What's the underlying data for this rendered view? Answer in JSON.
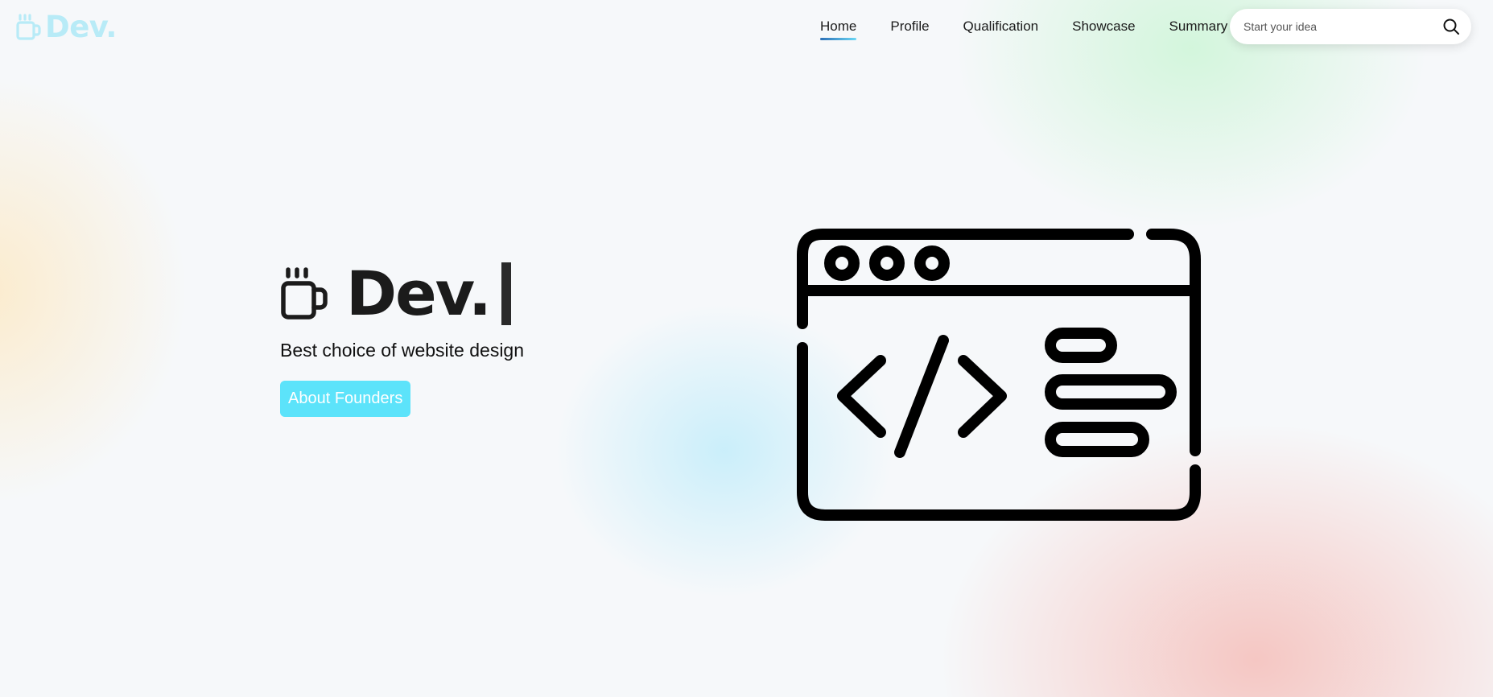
{
  "brand": {
    "name": "Dev.",
    "icon": "mug-icon",
    "color": "#b8ebf7"
  },
  "nav": {
    "items": [
      {
        "label": "Home",
        "active": true
      },
      {
        "label": "Profile",
        "active": false
      },
      {
        "label": "Qualification",
        "active": false
      },
      {
        "label": "Showcase",
        "active": false
      },
      {
        "label": "Summary",
        "active": false
      }
    ]
  },
  "search": {
    "placeholder": "Start your idea",
    "icon": "search-icon"
  },
  "hero": {
    "title": "Dev.",
    "icon": "mug-icon",
    "tagline": "Best choice of website design",
    "cta_label": "About Founders",
    "cta_color": "#5ce3fa"
  },
  "illustration": {
    "icon": "code-window-icon"
  }
}
